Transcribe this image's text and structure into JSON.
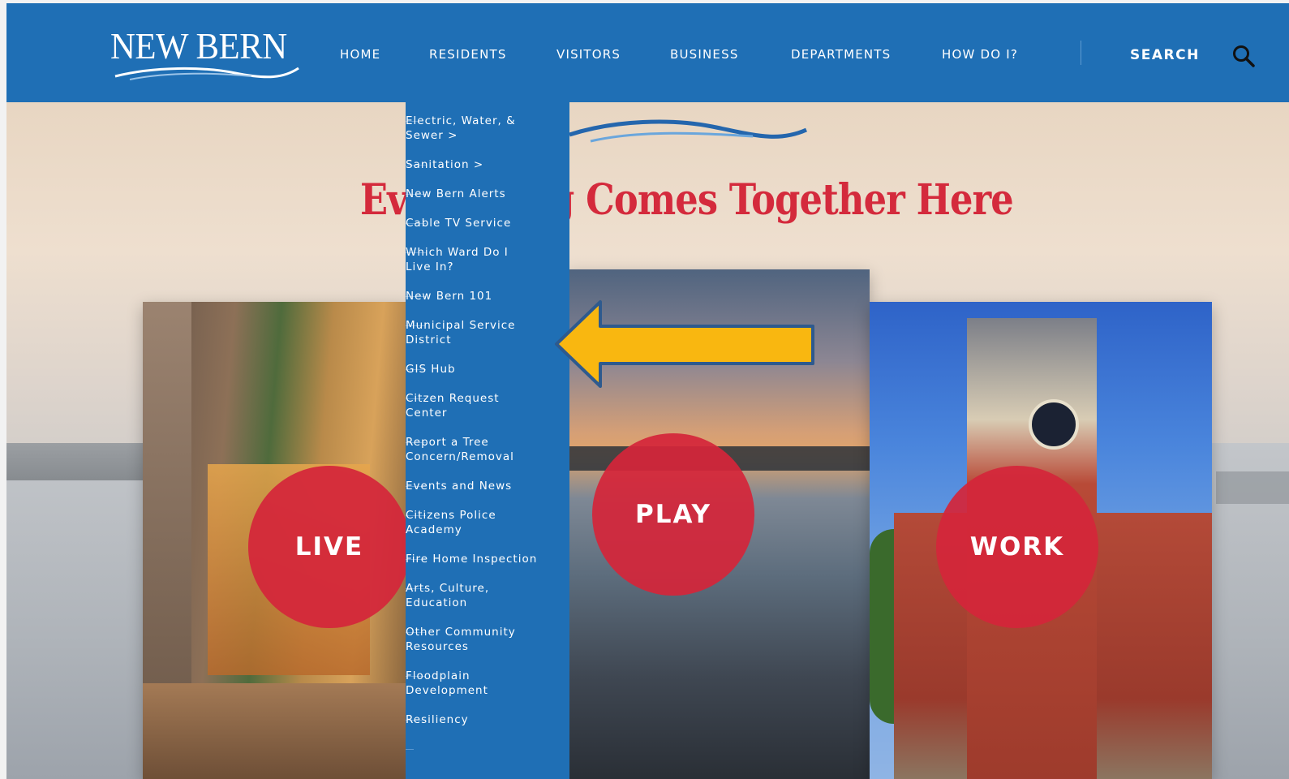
{
  "logo": {
    "text": "NEW BERN"
  },
  "nav": {
    "items": [
      "HOME",
      "RESIDENTS",
      "VISITORS",
      "BUSINESS",
      "DEPARTMENTS",
      "HOW DO I?"
    ],
    "search_label": "SEARCH"
  },
  "hero": {
    "title": "Everything Comes Together Here"
  },
  "dropdown": {
    "items": [
      [
        "Electric, Water, &",
        "Sewer >"
      ],
      [
        "Sanitation >"
      ],
      [
        "New Bern Alerts"
      ],
      [
        "Cable TV Service"
      ],
      [
        "Which Ward Do I",
        "Live In?"
      ],
      [
        "New Bern 101"
      ],
      [
        "Municipal Service",
        "District"
      ],
      [
        "GIS Hub"
      ],
      [
        "Citzen Request",
        "Center"
      ],
      [
        "Report a Tree",
        "Concern/Removal"
      ],
      [
        "Events and News"
      ],
      [
        "Citizens Police",
        "Academy"
      ],
      [
        "Fire Home Inspection"
      ],
      [
        "Arts, Culture,",
        "Education"
      ],
      [
        "Other Community",
        "Resources"
      ],
      [
        "Floodplain",
        "Development"
      ],
      [
        "Resiliency"
      ]
    ]
  },
  "cards": {
    "live_label": "LIVE",
    "play_label": "PLAY",
    "work_label": "WORK"
  },
  "colors": {
    "header_blue": "#1f6fb5",
    "accent_red": "#d42a3c",
    "arrow_yellow": "#f9b710",
    "arrow_outline": "#2e5a8e"
  },
  "icons": {
    "search": "magnifier-icon",
    "annotation": "left-arrow-icon"
  }
}
